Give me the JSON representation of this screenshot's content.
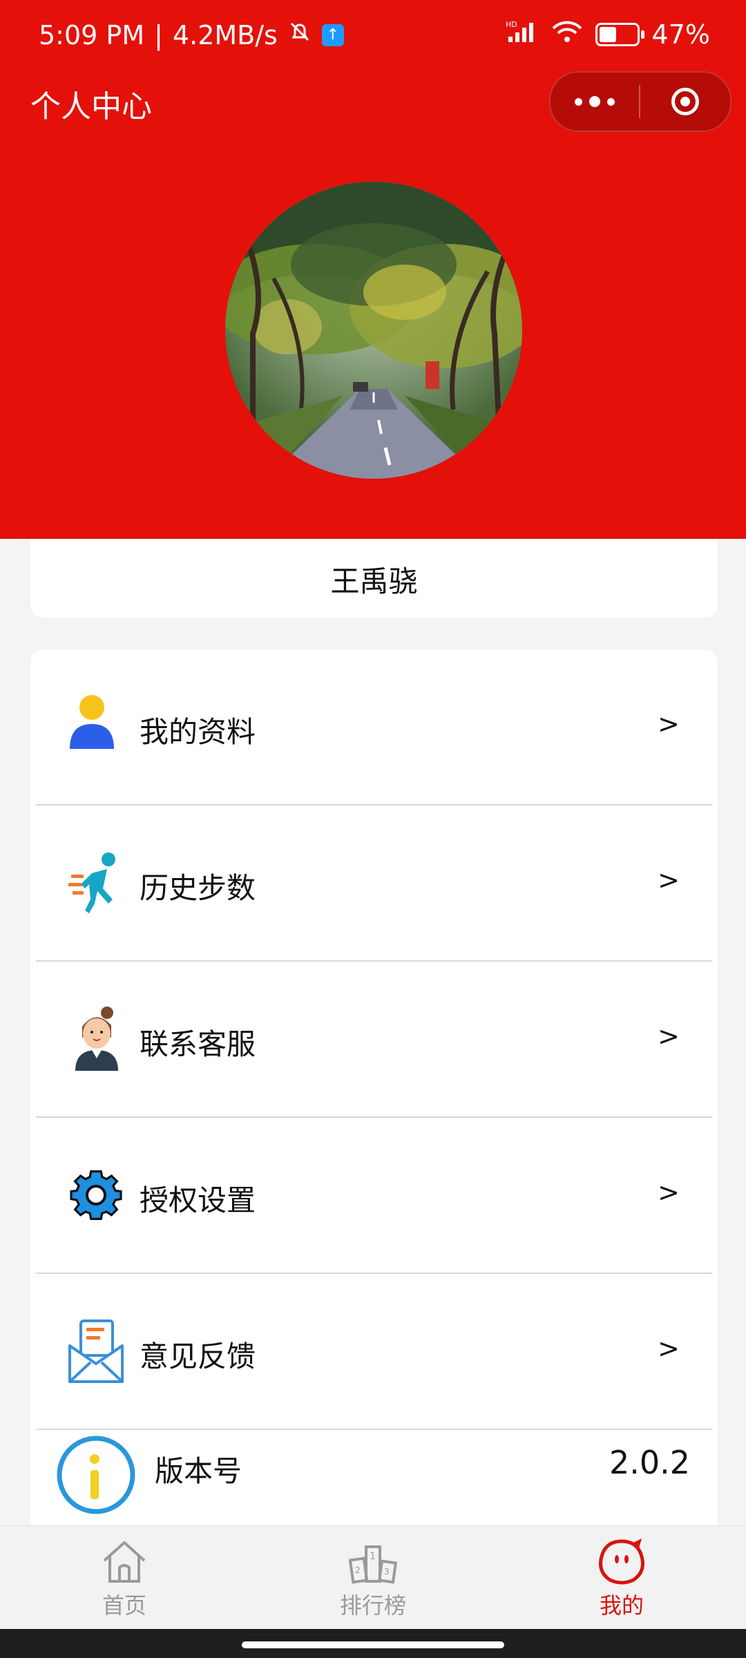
{
  "status": {
    "time": "5:09 PM",
    "speed": "4.2MB/s",
    "signal_label": "HD",
    "battery": "47%",
    "battery_level": 0.47
  },
  "header": {
    "title": "个人中心",
    "accent_color": "#e3110a"
  },
  "profile": {
    "name": "王禹骁"
  },
  "menu": [
    {
      "label": "我的资料",
      "icon": "person-icon",
      "arrow": ">"
    },
    {
      "label": "历史步数",
      "icon": "runner-icon",
      "arrow": ">"
    },
    {
      "label": "联系客服",
      "icon": "customer-service-icon",
      "arrow": ">"
    },
    {
      "label": "授权设置",
      "icon": "gear-icon",
      "arrow": ">"
    },
    {
      "label": "意见反馈",
      "icon": "mail-feedback-icon",
      "arrow": ">"
    }
  ],
  "version": {
    "label": "版本号",
    "value": "2.0.2",
    "icon": "info-icon"
  },
  "tabs": [
    {
      "label": "首页",
      "icon": "home-icon",
      "active": false
    },
    {
      "label": "排行榜",
      "icon": "podium-icon",
      "active": false
    },
    {
      "label": "我的",
      "icon": "mascot-icon",
      "active": true
    }
  ]
}
